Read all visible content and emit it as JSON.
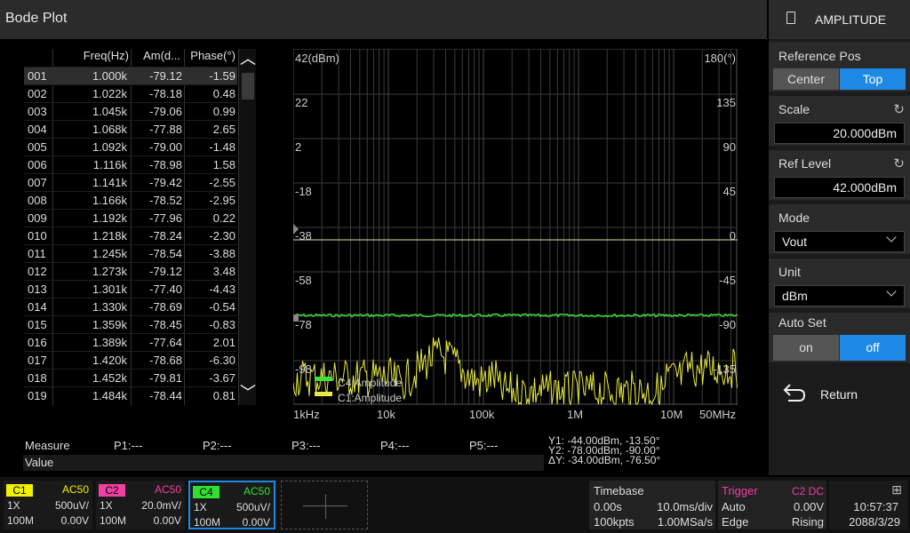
{
  "title": "Bode Plot",
  "table": {
    "headers": [
      "Freq(Hz)",
      "Am(d...",
      "Phase(°)"
    ],
    "rows": [
      [
        "001",
        "1.000k",
        "-79.12",
        "-1.59"
      ],
      [
        "002",
        "1.022k",
        "-78.18",
        "0.48"
      ],
      [
        "003",
        "1.045k",
        "-79.06",
        "0.99"
      ],
      [
        "004",
        "1.068k",
        "-77.88",
        "2.65"
      ],
      [
        "005",
        "1.092k",
        "-79.00",
        "-1.48"
      ],
      [
        "006",
        "1.116k",
        "-78.98",
        "1.58"
      ],
      [
        "007",
        "1.141k",
        "-79.42",
        "-2.55"
      ],
      [
        "008",
        "1.166k",
        "-78.52",
        "-2.95"
      ],
      [
        "009",
        "1.192k",
        "-77.96",
        "0.22"
      ],
      [
        "010",
        "1.218k",
        "-78.24",
        "-2.30"
      ],
      [
        "011",
        "1.245k",
        "-78.54",
        "-3.88"
      ],
      [
        "012",
        "1.273k",
        "-79.12",
        "3.48"
      ],
      [
        "013",
        "1.301k",
        "-77.40",
        "-4.43"
      ],
      [
        "014",
        "1.330k",
        "-78.69",
        "-0.54"
      ],
      [
        "015",
        "1.359k",
        "-78.45",
        "-0.83"
      ],
      [
        "016",
        "1.389k",
        "-77.64",
        "2.01"
      ],
      [
        "017",
        "1.420k",
        "-78.68",
        "-6.30"
      ],
      [
        "018",
        "1.452k",
        "-79.81",
        "-3.67"
      ],
      [
        "019",
        "1.484k",
        "-78.44",
        "0.81"
      ]
    ],
    "scroll_up": "︿",
    "scroll_down": "﹀"
  },
  "plot": {
    "left_axis": [
      "42(dBm)",
      "22",
      "2",
      "-18",
      "-38",
      "-58",
      "-78",
      "-98"
    ],
    "right_axis": [
      "180(°)",
      "135",
      "90",
      "45",
      "0",
      "-45",
      "-90",
      "-135"
    ],
    "x_labels": [
      "1kHz",
      "10k",
      "100k",
      "1M",
      "10M",
      "50MHz"
    ],
    "legend": [
      "C4:Amplitude",
      "C1:Amplitude"
    ],
    "colors": {
      "c1": "#e8e840",
      "c4": "#40e040",
      "grid": "#3c3c3c"
    }
  },
  "measure": {
    "label": "Measure",
    "p": [
      "P1:---",
      "P2:---",
      "P3:---",
      "P4:---",
      "P5:---"
    ],
    "value_label": "Value"
  },
  "cursors": {
    "y1": "Y1: -44.00dBm, -13.50°",
    "y2": "Y2: -78.00dBm, -90.00°",
    "dy": "ΔY: -34.00dBm, -76.50°"
  },
  "side": {
    "title": "AMPLITUDE",
    "ref_pos": {
      "label": "Reference Pos",
      "options": [
        "Center",
        "Top"
      ],
      "selected": "Top"
    },
    "scale": {
      "label": "Scale",
      "value": "20.000dBm"
    },
    "ref_level": {
      "label": "Ref Level",
      "value": "42.000dBm"
    },
    "mode": {
      "label": "Mode",
      "value": "Vout"
    },
    "unit": {
      "label": "Unit",
      "value": "dBm"
    },
    "auto_set": {
      "label": "Auto Set",
      "options": [
        "on",
        "off"
      ],
      "selected": "off"
    },
    "return_label": "Return"
  },
  "channels": [
    {
      "name": "C1",
      "coupling": "AC50",
      "probe": "1X",
      "scale": "500uV/",
      "bw": "100M",
      "offset": "0.00V",
      "color": "#f0f000"
    },
    {
      "name": "C2",
      "coupling": "AC50",
      "probe": "1X",
      "scale": "20.0mV/",
      "bw": "100M",
      "offset": "0.00V",
      "color": "#f040a0"
    },
    {
      "name": "C4",
      "coupling": "AC50",
      "probe": "1X",
      "scale": "500uV/",
      "bw": "100M",
      "offset": "0.00V",
      "color": "#30e030"
    }
  ],
  "timebase": {
    "label": "Timebase",
    "delay": "0.00s",
    "div": "10.0ms/div",
    "points": "100kpts",
    "rate": "1.00MSa/s"
  },
  "trigger": {
    "label": "Trigger",
    "source": "C2 DC",
    "mode": "Auto",
    "level": "0.00V",
    "type": "Edge",
    "slope": "Rising"
  },
  "clock": {
    "time": "10:57:37",
    "date": "2088/3/29"
  }
}
